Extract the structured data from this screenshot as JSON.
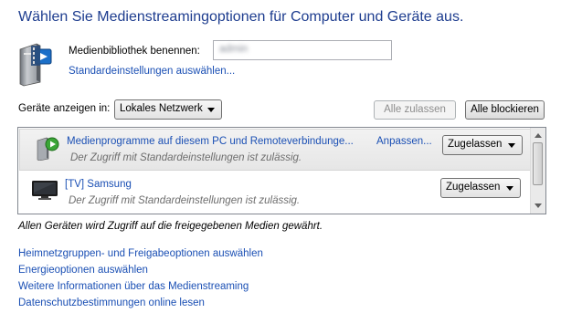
{
  "title": "Wählen Sie Medienstreamingoptionen für Computer und Geräte aus.",
  "library": {
    "label": "Medienbibliothek benennen:",
    "value": "admin",
    "default_link": "Standardeinstellungen auswählen..."
  },
  "devices": {
    "label": "Geräte anzeigen in:",
    "network_select": "Lokales Netzwerk",
    "allow_all": "Alle zulassen",
    "block_all": "Alle blockieren",
    "items": [
      {
        "name": "Medienprogramme auf diesem PC und Remoteverbindunge...",
        "description": "Der Zugriff mit Standardeinstellungen ist zulässig.",
        "adjust_link": "Anpassen...",
        "permission": "Zugelassen",
        "icon": "media-programs-icon"
      },
      {
        "name": "[TV] Samsung",
        "description": "Der Zugriff mit Standardeinstellungen ist zulässig.",
        "adjust_link": "",
        "permission": "Zugelassen",
        "icon": "tv-icon"
      }
    ]
  },
  "footer_note": "Allen Geräten wird Zugriff auf die freigegebenen Medien gewährt.",
  "links": [
    "Heimnetzgruppen- und Freigabeoptionen auswählen",
    "Energieoptionen auswählen",
    "Weitere Informationen über das Medienstreaming",
    "Datenschutzbestimmungen online lesen"
  ],
  "colors": {
    "title": "#1e3d8f",
    "link": "#1a4fb4",
    "description": "#6d6d6d"
  }
}
